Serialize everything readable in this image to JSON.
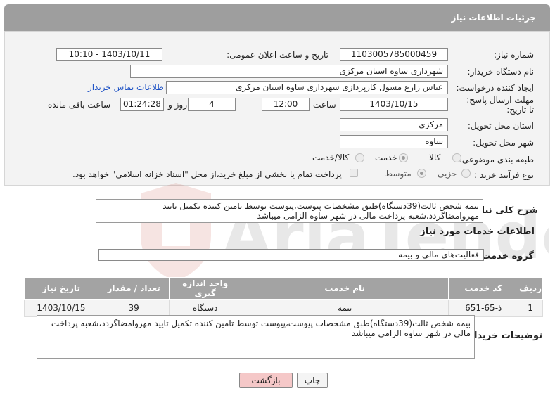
{
  "header": {
    "title": "جزئیات اطلاعات نیاز"
  },
  "form": {
    "need_number_label": "شماره نیاز:",
    "need_number": "1103005785000459",
    "announce_label": "تاریخ و ساعت اعلان عمومی:",
    "announce_value": "1403/10/11 - 10:10",
    "buyer_label": "نام دستگاه خریدار:",
    "buyer_value": "شهرداری ساوه استان مرکزی",
    "creator_label": "ایجاد کننده درخواست:",
    "creator_value": "عباس زارع مسول کارپردازی شهرداری ساوه استان مرکزی",
    "contact_link": "اطلاعات تماس خریدار",
    "deadline_label": "مهلت ارسال پاسخ: تا تاریخ:",
    "deadline_date": "1403/10/15",
    "time_label": "ساعت",
    "deadline_time": "12:00",
    "days_value": "4",
    "days_label": "روز و",
    "remaining_time": "01:24:28",
    "remaining_label": "ساعت باقی مانده",
    "province_label": "استان محل تحویل:",
    "province_value": "مرکزی",
    "city_label": "شهر محل تحویل:",
    "city_value": "ساوه",
    "category_label": "طبقه بندی موضوعی:",
    "category_options": [
      "کالا",
      "خدمت",
      "کالا/خدمت"
    ],
    "category_selected": 1,
    "process_label": "نوع فرآیند خرید :",
    "process_options": [
      "جزیی",
      "متوسط"
    ],
    "process_selected": 1,
    "payment_note": "پرداخت تمام یا بخشی از مبلغ خرید،از محل \"اسناد خزانه اسلامی\" خواهد بود."
  },
  "summary": {
    "label": "شرح کلی نیاز:",
    "text": "بیمه شخص ثالث(39دستگاه)طبق مشخصات پیوست،پیوست توسط تامین کننده تکمیل تایید مهروامضاگردد،شعبه پرداخت مالی در شهر ساوه الزامی میباشد"
  },
  "services": {
    "section_title": "اطلاعات خدمات مورد نیاز",
    "group_label": "گروه خدمت:",
    "group_value": "فعالیت‌های مالی و بیمه",
    "columns": [
      "ردیف",
      "کد خدمت",
      "نام خدمت",
      "واحد اندازه گیری",
      "تعداد / مقدار",
      "تاریخ نیاز"
    ],
    "rows": [
      [
        "1",
        "ذ-65-651",
        "بیمه",
        "دستگاه",
        "39",
        "1403/10/15"
      ]
    ]
  },
  "buyer_notes": {
    "label": "توضیحات خریدار:",
    "text": "بیمه شخص ثالث(39دستگاه)طبق مشخصات پیوست،پیوست توسط تامین کننده تکمیل تایید مهروامضاگردد،شعبه پرداخت مالی در شهر ساوه الزامی میباشد"
  },
  "buttons": {
    "print": "چاپ",
    "back": "بازگشت"
  },
  "watermark": {
    "text": "AriaTender.neT"
  },
  "colors": {
    "header": "#9e9e9e",
    "link": "#1a4fc4",
    "back_button": "#f5c8c8"
  }
}
